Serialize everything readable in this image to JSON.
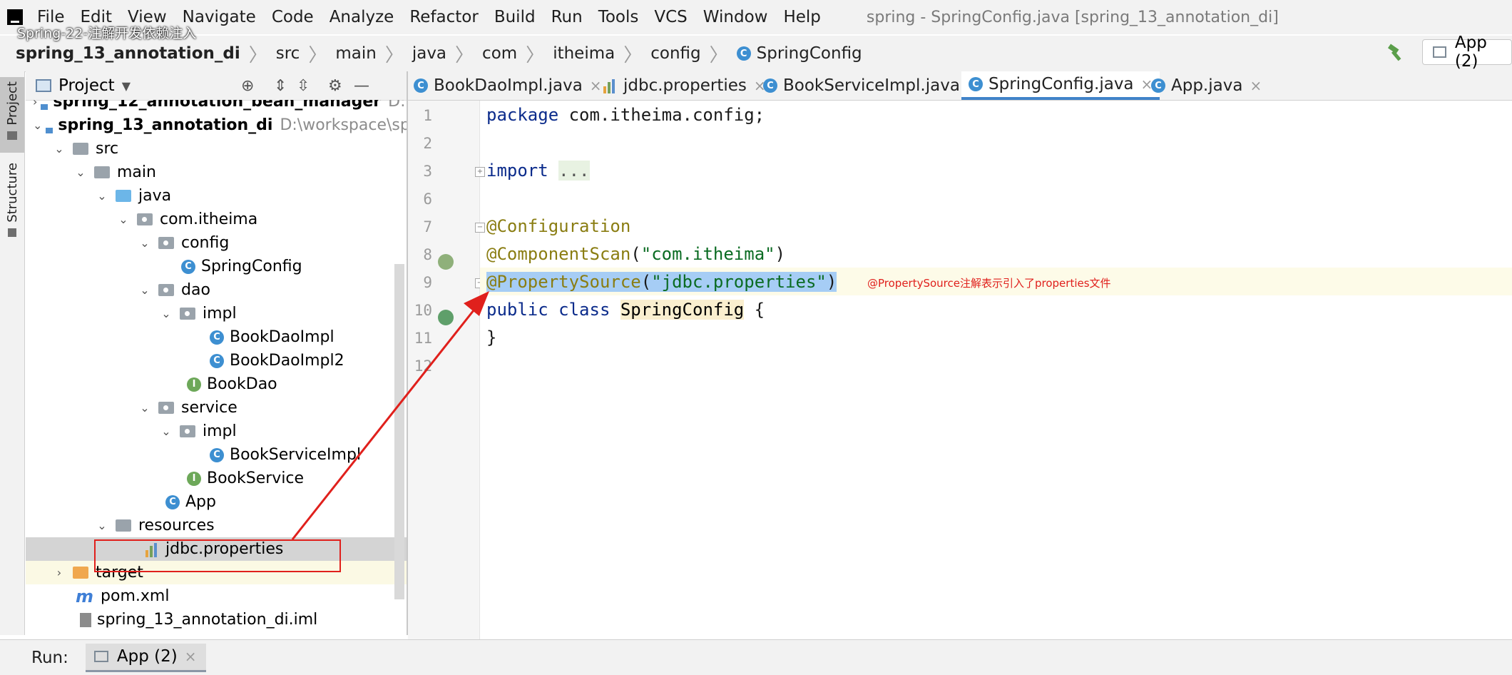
{
  "menubar": {
    "items": [
      "File",
      "Edit",
      "View",
      "Navigate",
      "Code",
      "Analyze",
      "Refactor",
      "Build",
      "Run",
      "Tools",
      "VCS",
      "Window",
      "Help"
    ],
    "window_title": "spring - SpringConfig.java [spring_13_annotation_di]"
  },
  "video_title": "Spring-22-注解开发依赖注入",
  "breadcrumb": [
    "spring_13_annotation_di",
    "src",
    "main",
    "java",
    "com",
    "itheima",
    "config",
    "SpringConfig"
  ],
  "toolbar": {
    "run_config": "App (2)"
  },
  "side_tabs": {
    "project": "Project",
    "structure": "Structure"
  },
  "project_panel": {
    "title": "Project",
    "tree": [
      {
        "label": "spring_12_annotation_bean_manager",
        "path": "D:\\workspace",
        "icon": "project-folder-icon",
        "expanded": false
      },
      {
        "label": "spring_13_annotation_di",
        "path": "D:\\workspace\\spring",
        "icon": "project-folder-icon",
        "expanded": true
      },
      {
        "label": "src",
        "icon": "folder-icon",
        "expanded": true
      },
      {
        "label": "main",
        "icon": "folder-icon",
        "expanded": true
      },
      {
        "label": "java",
        "icon": "source-folder-icon",
        "expanded": true
      },
      {
        "label": "com.itheima",
        "icon": "package-icon",
        "expanded": true
      },
      {
        "label": "config",
        "icon": "package-icon",
        "expanded": true
      },
      {
        "label": "SpringConfig",
        "icon": "class-icon"
      },
      {
        "label": "dao",
        "icon": "package-icon",
        "expanded": true
      },
      {
        "label": "impl",
        "icon": "package-icon",
        "expanded": true
      },
      {
        "label": "BookDaoImpl",
        "icon": "class-icon"
      },
      {
        "label": "BookDaoImpl2",
        "icon": "class-icon"
      },
      {
        "label": "BookDao",
        "icon": "interface-icon"
      },
      {
        "label": "service",
        "icon": "package-icon",
        "expanded": true
      },
      {
        "label": "impl",
        "icon": "package-icon",
        "expanded": true
      },
      {
        "label": "BookServiceImpl",
        "icon": "class-icon"
      },
      {
        "label": "BookService",
        "icon": "interface-icon"
      },
      {
        "label": "App",
        "icon": "runnable-class-icon"
      },
      {
        "label": "resources",
        "icon": "resources-folder-icon",
        "expanded": true
      },
      {
        "label": "jdbc.properties",
        "icon": "properties-file-icon",
        "selected": true
      },
      {
        "label": "target",
        "icon": "excluded-folder-icon",
        "expanded": false
      },
      {
        "label": "pom.xml",
        "icon": "maven-icon"
      },
      {
        "label": "spring_13_annotation_di.iml",
        "icon": "module-file-icon"
      }
    ]
  },
  "editor": {
    "tabs": [
      {
        "label": "BookDaoImpl.java",
        "icon": "class-icon"
      },
      {
        "label": "jdbc.properties",
        "icon": "properties-file-icon"
      },
      {
        "label": "BookServiceImpl.java",
        "icon": "class-icon"
      },
      {
        "label": "SpringConfig.java",
        "icon": "class-icon",
        "active": true
      },
      {
        "label": "App.java",
        "icon": "runnable-class-icon"
      }
    ],
    "close_glyph": "×",
    "lines": [
      {
        "num": "1",
        "parts": [
          [
            "kw",
            "package "
          ],
          [
            "pkg",
            "com.itheima.config;"
          ]
        ]
      },
      {
        "num": "2",
        "parts": []
      },
      {
        "num": "3",
        "parts": [
          [
            "kw",
            "import "
          ],
          [
            "folded",
            "..."
          ]
        ]
      },
      {
        "num": "6",
        "parts": []
      },
      {
        "num": "7",
        "parts": [
          [
            "ann",
            "@Configuration"
          ]
        ]
      },
      {
        "num": "8",
        "parts": [
          [
            "ann",
            "@ComponentScan"
          ],
          [
            "pkg",
            "("
          ],
          [
            "str",
            "\"com.itheima\""
          ],
          [
            "pkg",
            ")"
          ]
        ]
      },
      {
        "num": "9",
        "parts": [
          [
            "sel-ann",
            "@PropertySource"
          ],
          [
            "sel",
            "("
          ],
          [
            "sel-str",
            "\"jdbc.properties\""
          ],
          [
            "sel",
            ")"
          ]
        ]
      },
      {
        "num": "10",
        "parts": [
          [
            "kw",
            "public class "
          ],
          [
            "cls",
            "SpringConfig"
          ],
          [
            "pkg",
            " {"
          ]
        ]
      },
      {
        "num": "11",
        "parts": [
          [
            "pkg",
            "}"
          ]
        ]
      },
      {
        "num": "12",
        "parts": []
      }
    ]
  },
  "annotation_note": "@PropertySource注解表示引入了properties文件",
  "runbar": {
    "label": "Run:",
    "tab": "App (2)"
  },
  "colors": {
    "accent": "#4083c9",
    "highlight_red": "#e0201c",
    "selection": "#a6cdf5"
  }
}
